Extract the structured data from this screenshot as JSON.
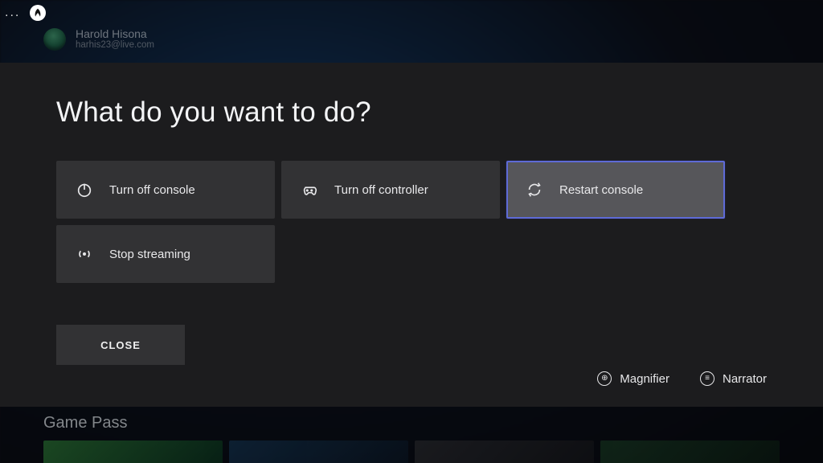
{
  "system": {
    "more_label": "...",
    "logo": "xbox-logo"
  },
  "profile": {
    "name": "Harold Hisona",
    "email": "harhis23@live.com"
  },
  "dialog": {
    "title": "What do you want to do?",
    "options": [
      {
        "label": "Turn off console",
        "icon": "power-icon"
      },
      {
        "label": "Turn off controller",
        "icon": "controller-icon"
      },
      {
        "label": "Restart console",
        "icon": "restart-icon"
      },
      {
        "label": "Stop streaming",
        "icon": "stream-icon"
      }
    ],
    "selected_index": 2,
    "close_label": "CLOSE",
    "accessibility": {
      "magnifier_label": "Magnifier",
      "narrator_label": "Narrator"
    }
  },
  "background": {
    "section_label": "Game Pass"
  },
  "colors": {
    "focus": "#5e6bd6",
    "panel": "#1c1c1e",
    "button": "#323234",
    "button_selected": "#56565a"
  }
}
